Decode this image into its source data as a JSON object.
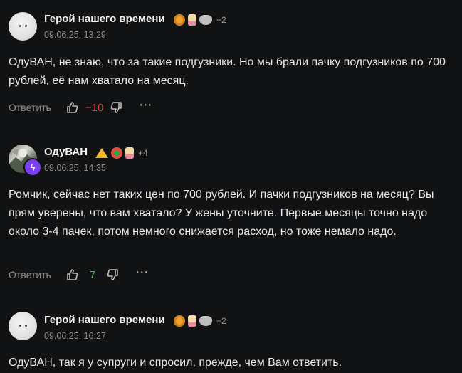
{
  "comments": [
    {
      "author": "Герой нашего времени",
      "extra_awards": "+2",
      "date": "09.06.25, 13:29",
      "text": "ОдуВАН, не знаю, что за такие подгузники. Но мы брали пачку подгузников по 700 рублей, её нам хватало на месяц.",
      "reply_label": "Ответить",
      "score": "−10",
      "score_color": "#e2453c"
    },
    {
      "author": "ОдуВАН",
      "extra_awards": "+4",
      "date": "09.06.25, 14:35",
      "text": "Ромчик, сейчас нет таких цен по 700 рублей. И пачки подгузников на месяц? Вы прям уверены, что вам хватало? У жены уточните. Первые месяцы точно надо около 3-4 пачек, потом немного снижается расход, но тоже немало надо.",
      "reply_label": "Ответить",
      "score": "7",
      "score_color": "#3fb84f"
    },
    {
      "author": "Герой нашего времени",
      "extra_awards": "+2",
      "date": "09.06.25, 16:27",
      "text": "ОдуВАН, так я у супруги и спросил, прежде, чем Вам ответить."
    }
  ],
  "icons": {
    "more": "⋯",
    "bolt": "ϟ"
  }
}
